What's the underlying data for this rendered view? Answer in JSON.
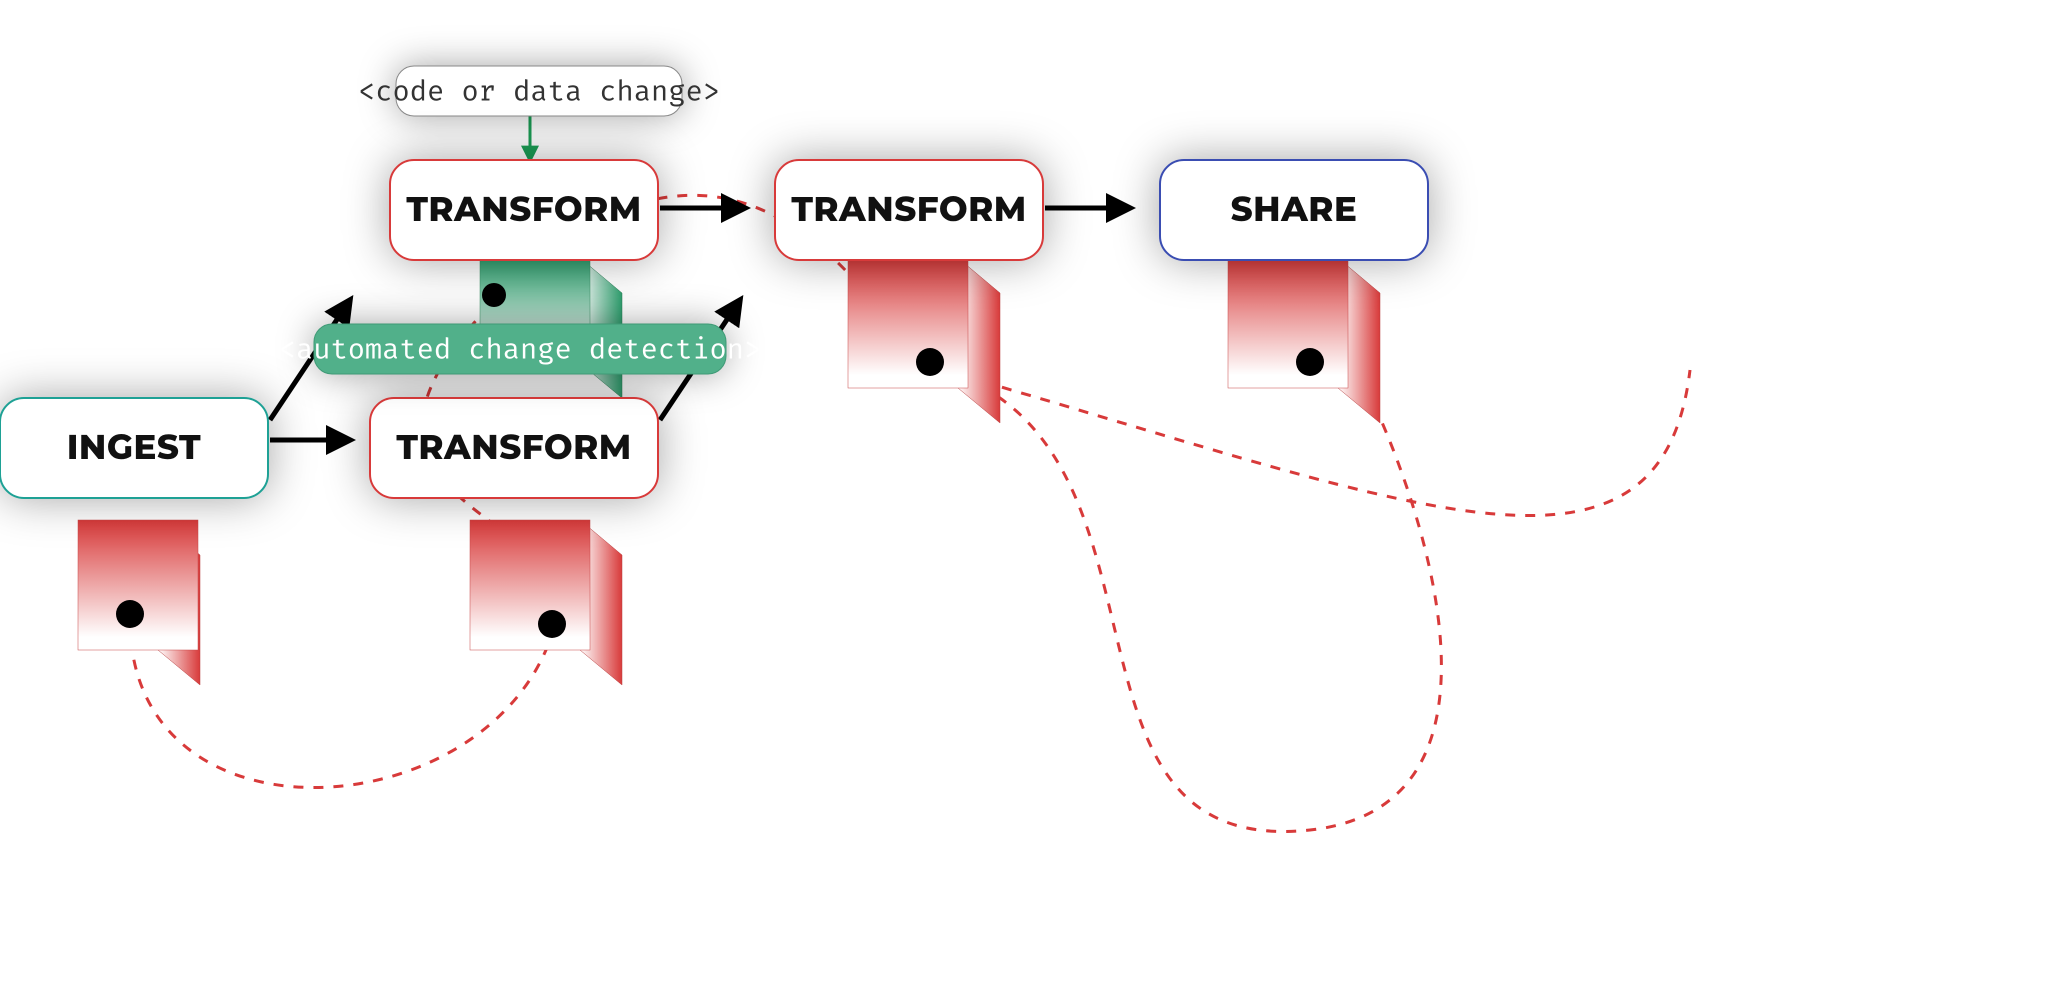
{
  "nodes": {
    "ingest": {
      "label": "INGEST"
    },
    "transformA": {
      "label": "TRANSFORM"
    },
    "transformB": {
      "label": "TRANSFORM"
    },
    "transformC": {
      "label": "TRANSFORM"
    },
    "share": {
      "label": "SHARE"
    }
  },
  "tags": {
    "code_change": {
      "label": "<code or data change>"
    },
    "detection": {
      "label": "<automated change detection>"
    }
  },
  "colors": {
    "ingest_border": "#1ea195",
    "transform_border": "#d83a3a",
    "share_border": "#3a4db2",
    "shadow": "rgba(0,0,0,0.35)",
    "arrow": "#000000",
    "arrow_green": "#1c9f56",
    "dashed": "#d83a3a",
    "green_fill": "#51b08a"
  }
}
